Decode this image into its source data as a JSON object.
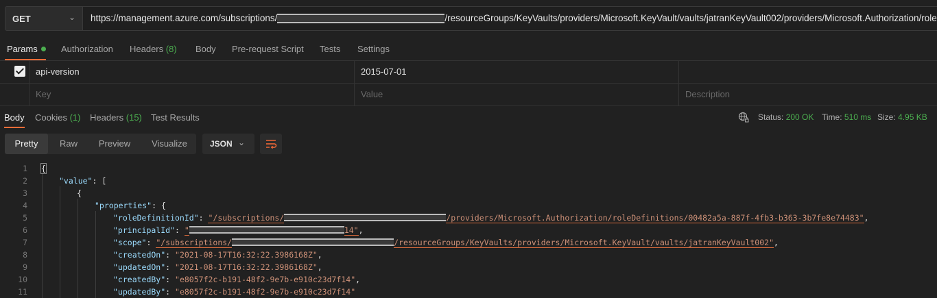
{
  "request": {
    "method": "GET",
    "url_prefix": "https://management.azure.com/subscriptions/",
    "url_suffix": "/resourceGroups/KeyVaults/providers/Microsoft.KeyVault/vaults/jatranKeyVault002/providers/Microsoft.Authorization/roleAss..."
  },
  "request_tabs": [
    {
      "label": "Params"
    },
    {
      "label": "Authorization"
    },
    {
      "label": "Headers",
      "count": "(8)"
    },
    {
      "label": "Body"
    },
    {
      "label": "Pre-request Script"
    },
    {
      "label": "Tests"
    },
    {
      "label": "Settings"
    }
  ],
  "params": {
    "row": {
      "key": "api-version",
      "value": "2015-07-01",
      "checked": true
    },
    "placeholders": {
      "key": "Key",
      "value": "Value",
      "description": "Description"
    }
  },
  "response_tabs": [
    {
      "label": "Body"
    },
    {
      "label": "Cookies",
      "count": "(1)"
    },
    {
      "label": "Headers",
      "count": "(15)"
    },
    {
      "label": "Test Results"
    }
  ],
  "response_status": {
    "status_label": "Status:",
    "status_value": "200 OK",
    "time_label": "Time:",
    "time_value": "510 ms",
    "size_label": "Size:",
    "size_value": "4.95 KB"
  },
  "view_modes": [
    "Pretty",
    "Raw",
    "Preview",
    "Visualize"
  ],
  "format": "JSON",
  "code": {
    "line_numbers": [
      "1",
      "2",
      "3",
      "4",
      "5",
      "6",
      "7",
      "8",
      "9",
      "10",
      "11"
    ],
    "l1": "{",
    "l2_key": "\"value\"",
    "l2_rest": ": [",
    "l3": "{",
    "l4_key": "\"properties\"",
    "l4_rest": ": {",
    "l5_key": "\"roleDefinitionId\"",
    "l5_a": "\"/subscriptions/",
    "l5_b": "/providers/Microsoft.Authorization/roleDefinitions/00482a5a-887f-4fb3-b363-3b7fe8e74483\"",
    "l6_key": "\"principalId\"",
    "l6_a": "\"",
    "l6_b": "14\"",
    "l7_key": "\"scope\"",
    "l7_a": "\"/subscriptions/",
    "l7_b": "/resourceGroups/KeyVaults/providers/Microsoft.KeyVault/vaults/jatranKeyVault002\"",
    "l8_key": "\"createdOn\"",
    "l8_val": "\"2021-08-17T16:32:22.3986168Z\"",
    "l9_key": "\"updatedOn\"",
    "l9_val": "\"2021-08-17T16:32:22.3986168Z\"",
    "l10_key": "\"createdBy\"",
    "l10_val": "\"e8057f2c-b191-48f2-9e7b-e910c23d7f14\"",
    "l11_key": "\"updatedBy\"",
    "l11_val": "\"e8057f2c-b191-48f2-9e7b-e910c23d7f14\""
  },
  "colors": {
    "accent": "#ff6c37",
    "success": "#4caf50"
  }
}
